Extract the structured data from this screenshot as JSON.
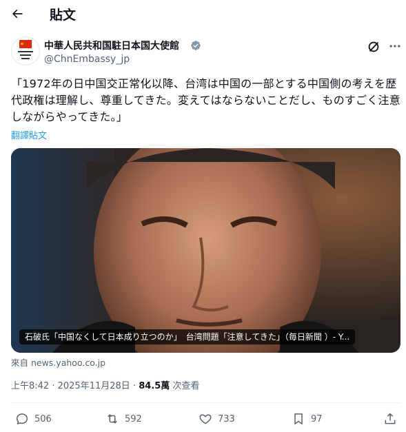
{
  "header": {
    "title": "貼文"
  },
  "author": {
    "display_name": "中華人民共和国駐日本国大使館",
    "handle": "@ChnEmbassy_jp",
    "avatar_text": "中華人民共和国 駐日本国 大使館",
    "verified": true
  },
  "post": {
    "text": "「1972年の日中国交正常化以降、台湾は中国の一部とする中国側の考えを歴代政権は理解し、尊重してきた。変えてはならないことだし、ものすごく注意しながらやってきた。」",
    "translate_label": "翻譯貼文"
  },
  "media": {
    "caption": "石破氏「中国なくして日本成り立つのか」　台湾問題「注意してきた」（毎日新聞 ）- Y...",
    "source": "來自 news.yahoo.co.jp"
  },
  "meta": {
    "time": "上午8:42",
    "separator": " · ",
    "date": "2025年11月28日",
    "views_count": "84.5萬",
    "views_label": " 次查看"
  },
  "actions": {
    "reply_count": "506",
    "retweet_count": "592",
    "like_count": "733",
    "bookmark_count": "97"
  },
  "colors": {
    "text": "#0f1419",
    "secondary": "#536471",
    "link": "#1d9bf0",
    "verified_badge": "#829aab",
    "avatar_flag": "#de2910"
  },
  "icons": [
    "back-arrow-icon",
    "verified-badge-icon",
    "grok-icon",
    "more-icon",
    "reply-icon",
    "retweet-icon",
    "like-icon",
    "bookmark-icon",
    "share-icon"
  ]
}
